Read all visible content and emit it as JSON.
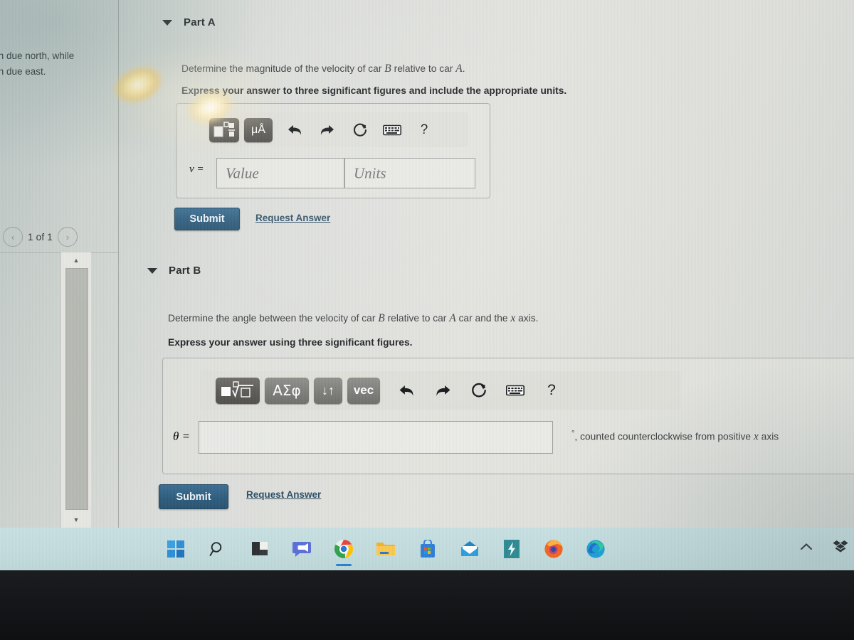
{
  "problem_statement": {
    "line1": "/h due north, while",
    "line2": "/h due east."
  },
  "pagination": {
    "prev_icon": "chevron-left-icon",
    "label": "1 of 1",
    "next_icon": "chevron-right-icon"
  },
  "scrollbar": {
    "up_icon": "triangle-up-icon",
    "down_icon": "triangle-down-icon"
  },
  "part_a": {
    "collapse_icon": "caret-down-icon",
    "title": "Part A",
    "question": "Determine the magnitude of the velocity of car B relative to car A.",
    "question_pre": "Determine the magnitude of the velocity of car ",
    "question_var1": "B",
    "question_mid": " relative to car ",
    "question_var2": "A",
    "question_post": ".",
    "instruction": "Express your answer to three significant figures and include the appropriate units.",
    "toolbar": [
      {
        "name": "template-button",
        "label": "□□"
      },
      {
        "name": "units-button",
        "label": "μÅ"
      },
      {
        "name": "undo-button",
        "label": "↶"
      },
      {
        "name": "redo-button",
        "label": "↷"
      },
      {
        "name": "reset-button",
        "label": "↺"
      },
      {
        "name": "keyboard-button",
        "label": "⌨"
      },
      {
        "name": "help-button",
        "label": "?"
      }
    ],
    "answer_label": "v =",
    "value_placeholder": "Value",
    "units_placeholder": "Units",
    "submit_label": "Submit",
    "request_answer_label": "Request Answer"
  },
  "part_b": {
    "collapse_icon": "caret-down-icon",
    "title": "Part B",
    "question": "Determine the angle between the velocity of car B relative to car A car and the x axis.",
    "question_pre": "Determine the angle between the velocity of car ",
    "question_var1": "B",
    "question_mid": " relative to car ",
    "question_var2": "A",
    "question_mid2": " car and the ",
    "question_var3": "x",
    "question_post": " axis.",
    "instruction": "Express your answer using three significant figures.",
    "toolbar": [
      {
        "name": "template-root-button",
        "label": "■√□"
      },
      {
        "name": "greek-button",
        "label": "ΑΣφ"
      },
      {
        "name": "arrows-button",
        "label": "↓↑"
      },
      {
        "name": "vector-button",
        "label": "vec"
      },
      {
        "name": "undo-button",
        "label": "↶"
      },
      {
        "name": "redo-button",
        "label": "↷"
      },
      {
        "name": "reset-button",
        "label": "↺"
      },
      {
        "name": "keyboard-button",
        "label": "⌨"
      },
      {
        "name": "help-button",
        "label": "?"
      }
    ],
    "answer_label": "θ =",
    "answer_value": "",
    "unit_suffix_degree": "°",
    "unit_suffix_text": ", counted counterclockwise from positive ",
    "unit_suffix_var": "x",
    "unit_suffix_tail": " axis",
    "submit_label": "Submit",
    "request_answer_label": "Request Answer"
  },
  "taskbar": {
    "items": [
      {
        "name": "start-button",
        "icon": "windows-logo-icon"
      },
      {
        "name": "search-button",
        "icon": "search-icon"
      },
      {
        "name": "taskview-button",
        "icon": "task-view-icon"
      },
      {
        "name": "chat-button",
        "icon": "chat-teams-icon"
      },
      {
        "name": "chrome-button",
        "icon": "chrome-icon",
        "active": true
      },
      {
        "name": "file-explorer-button",
        "icon": "folder-icon"
      },
      {
        "name": "microsoft-store-button",
        "icon": "store-icon"
      },
      {
        "name": "mail-button",
        "icon": "mail-icon"
      },
      {
        "name": "zoom-app-button",
        "icon": "lightning-app-icon"
      },
      {
        "name": "firefox-button",
        "icon": "firefox-icon"
      },
      {
        "name": "edge-button",
        "icon": "edge-icon"
      }
    ],
    "tray": [
      {
        "name": "show-hidden-icons-button",
        "icon": "chevron-up-icon"
      },
      {
        "name": "dropbox-tray-icon",
        "icon": "dropbox-icon"
      }
    ]
  },
  "colors": {
    "submit_blue": "#2f5d7e",
    "link_blue": "#2e4f66",
    "taskbar": "#c3dcde",
    "toolbar_button_dark": "#5b5955"
  }
}
